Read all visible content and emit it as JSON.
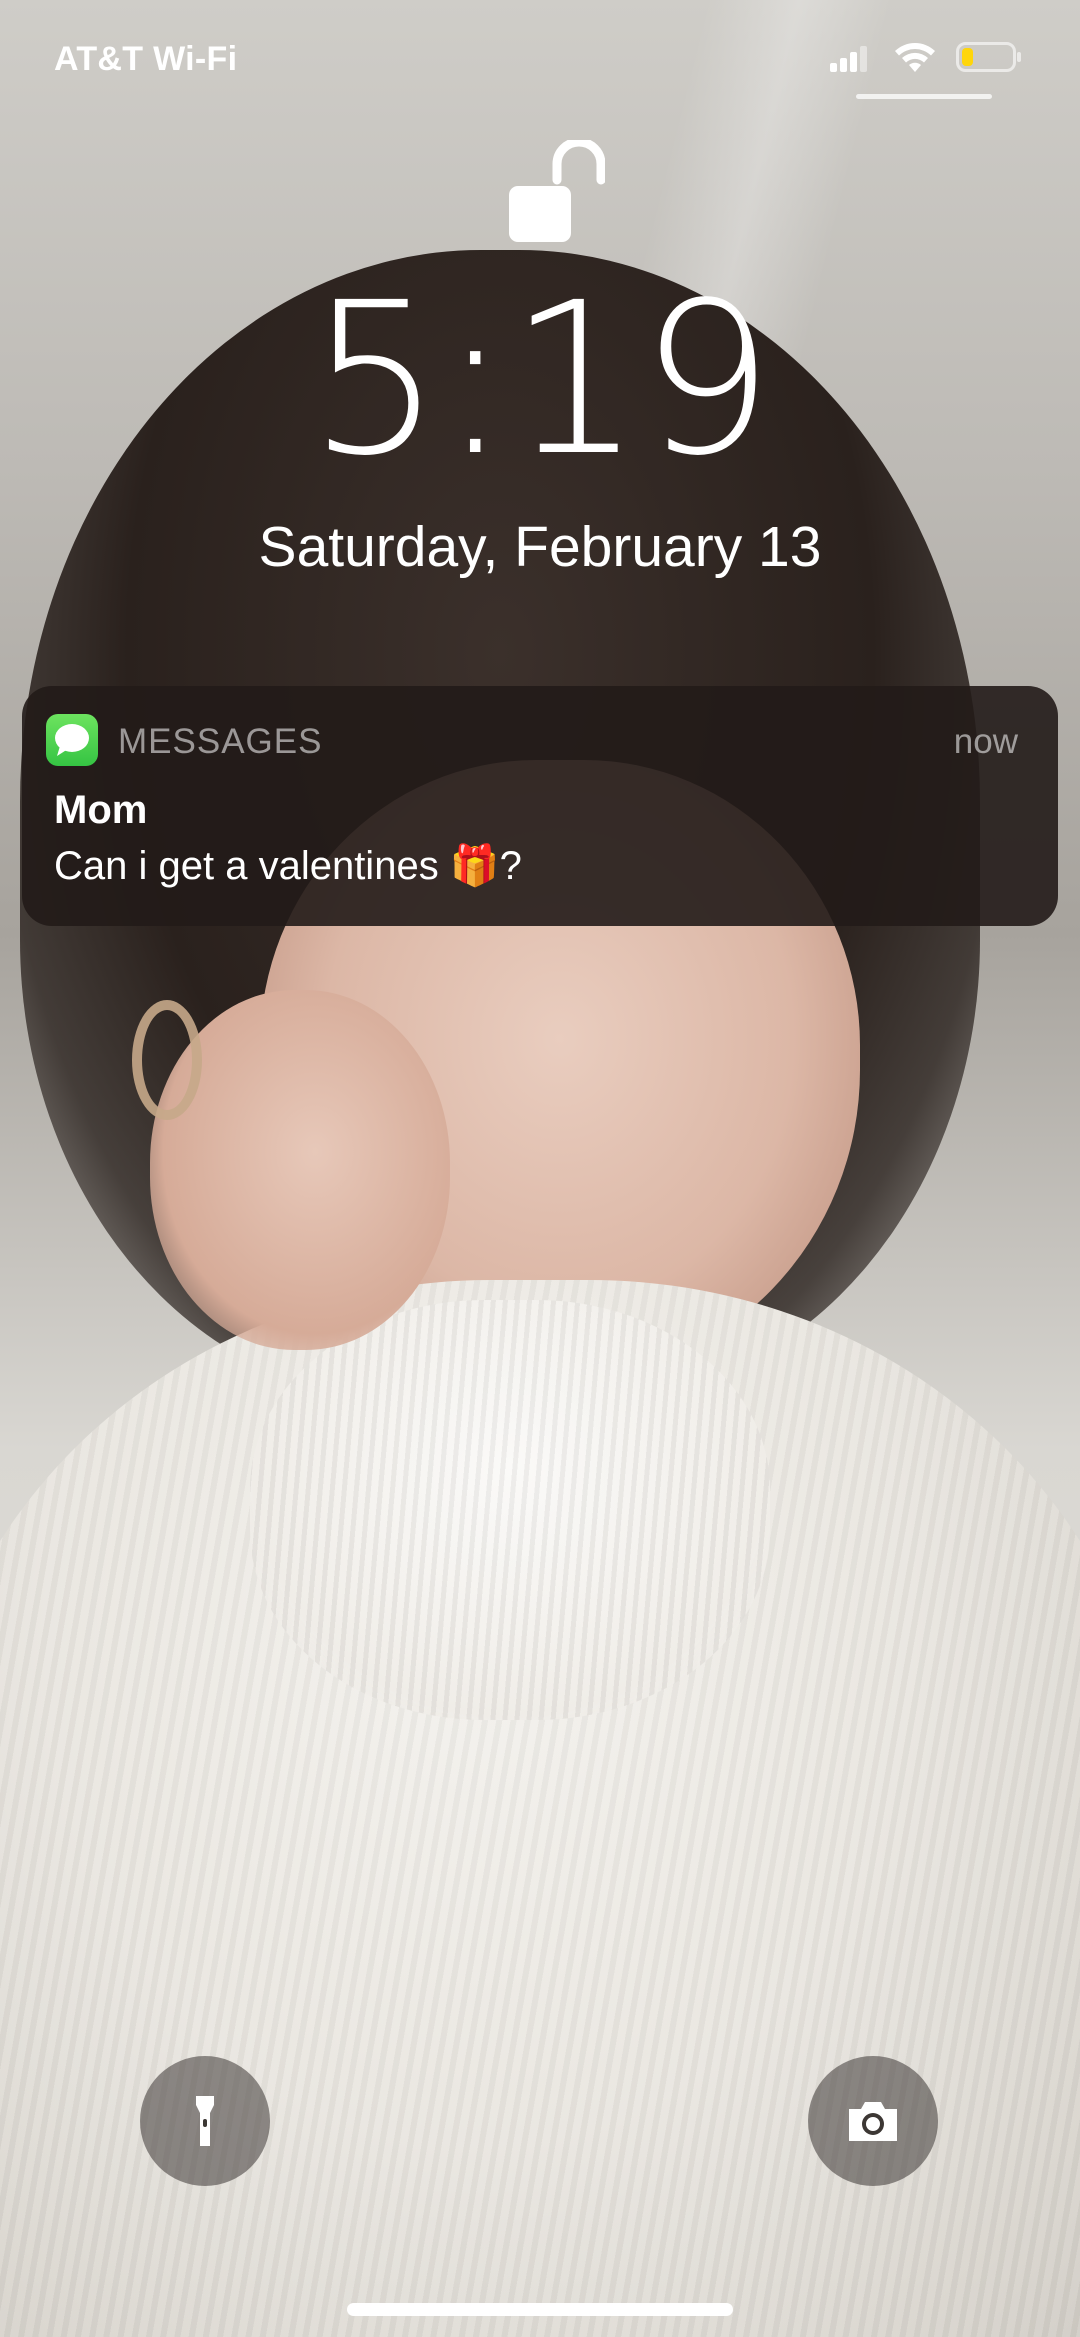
{
  "status_bar": {
    "carrier": "AT&T Wi-Fi",
    "signal_bars": 4,
    "battery_level": 0.2,
    "battery_color": "#ffd60a"
  },
  "lock": {
    "icon": "unlocked-padlock-icon"
  },
  "lock_screen": {
    "time": "5:19",
    "date": "Saturday, February 13"
  },
  "notification": {
    "app_icon": "messages-icon",
    "app_name": "MESSAGES",
    "time": "now",
    "sender": "Mom",
    "message": "Can i get a valentines 🎁?"
  },
  "quick_actions": {
    "flashlight_icon": "flashlight-icon",
    "camera_icon": "camera-icon"
  },
  "colors": {
    "messages_green": "#35c443",
    "notification_bg": "#221b18"
  }
}
